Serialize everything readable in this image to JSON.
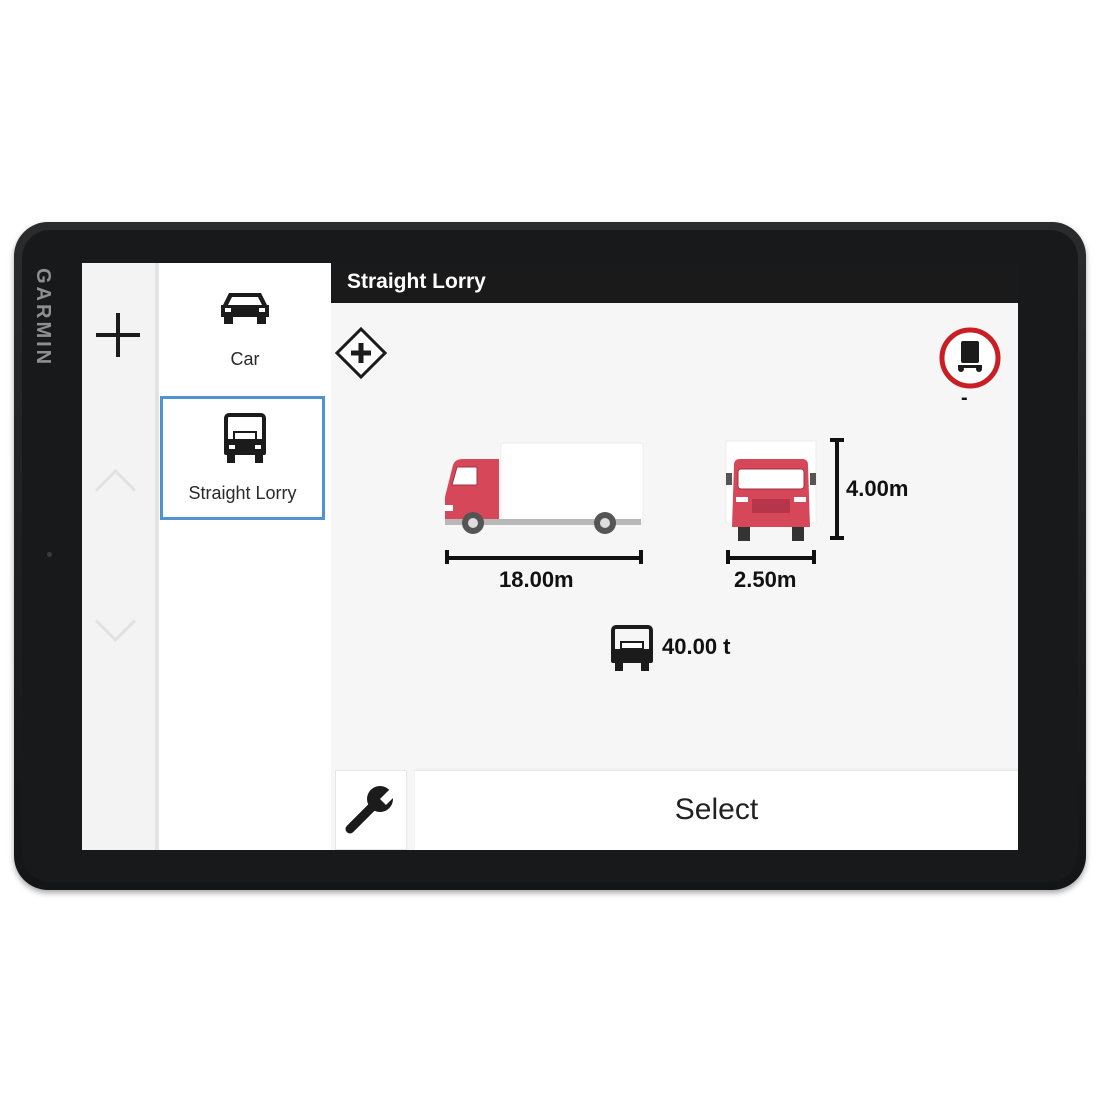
{
  "device": {
    "brand": "GARMIN"
  },
  "header": {
    "title": "Straight Lorry"
  },
  "vehicle_list": [
    {
      "label": "Car",
      "icon": "car-icon",
      "selected": false
    },
    {
      "label": "Straight Lorry",
      "icon": "lorry-icon",
      "selected": true
    }
  ],
  "profile": {
    "length": "18.00m",
    "width": "2.50m",
    "height": "4.00m",
    "weight": "40.00 t",
    "restriction_value": "-"
  },
  "actions": {
    "select_label": "Select"
  },
  "icons": {
    "add": "plus-icon",
    "scroll_up": "chevron-up-icon",
    "scroll_down": "chevron-down-icon",
    "add_profile": "diamond-plus-icon",
    "restriction": "no-trailer-sign-icon",
    "weight": "truck-weight-icon",
    "settings": "wrench-icon"
  },
  "colors": {
    "selection_border": "#4f93d0",
    "truck_red": "#d7475a",
    "sign_red": "#c81e24"
  }
}
